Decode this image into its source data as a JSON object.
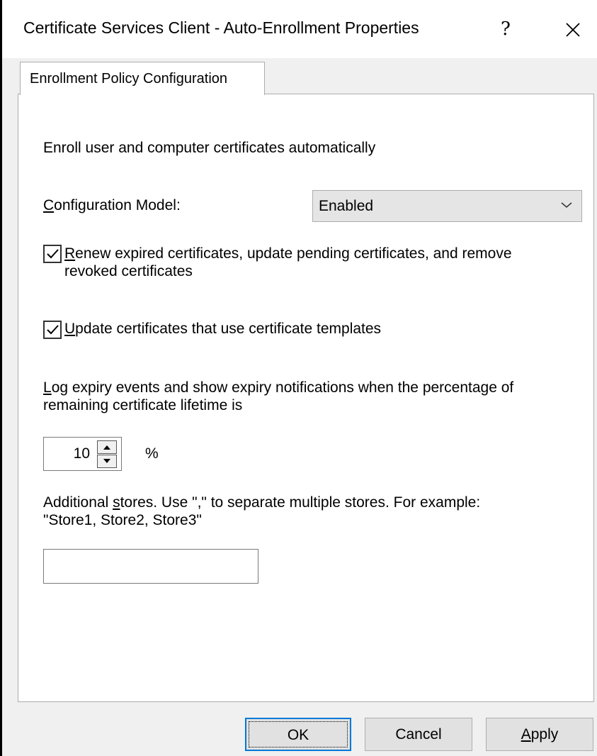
{
  "window": {
    "title": "Certificate Services Client - Auto-Enrollment Properties",
    "help_glyph": "?",
    "close_glyph": "✕"
  },
  "tabs": [
    {
      "label": "Enrollment Policy Configuration",
      "selected": true
    }
  ],
  "panel": {
    "heading": "Enroll user and computer certificates automatically",
    "config_model": {
      "label_underlined": "C",
      "label_rest": "onfiguration Model:",
      "selected_value": "Enabled"
    },
    "renew_checkbox": {
      "checked": true,
      "label_underlined": "R",
      "label_line1_rest": "enew expired certificates, update pending certificates, and remove",
      "label_line2": "revoked certificates"
    },
    "update_checkbox": {
      "checked": true,
      "label_underlined": "U",
      "label_rest": "pdate certificates that use certificate templates"
    },
    "expiry": {
      "label_underlined": "L",
      "label_line1_rest": "og expiry events and show expiry notifications when the percentage of",
      "label_line2": "remaining certificate lifetime is",
      "value": "10",
      "unit": "%"
    },
    "stores": {
      "label_line1_before": "Additional ",
      "label_underlined": "s",
      "label_line1_after": "tores. Use \",\" to separate multiple stores. For example:",
      "label_line2": "\"Store1, Store2, Store3\"",
      "value": ""
    }
  },
  "buttons": {
    "ok": "OK",
    "cancel": "Cancel",
    "apply_underlined": "A",
    "apply_rest": "pply"
  }
}
